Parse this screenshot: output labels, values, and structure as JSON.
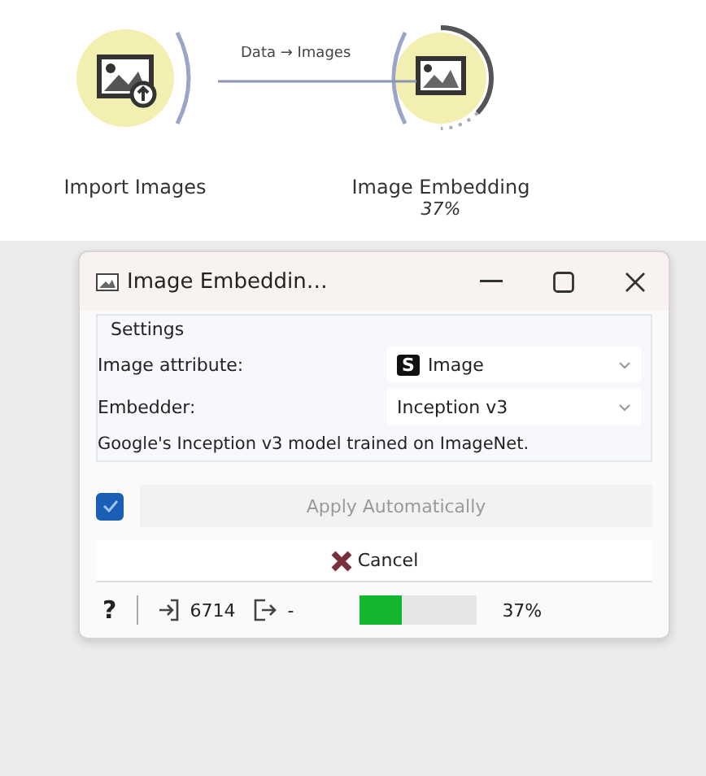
{
  "workflow": {
    "nodes": [
      {
        "kind": "import",
        "label": "Import Images"
      },
      {
        "kind": "embed",
        "label": "Image Embedding",
        "progress_text": "37%",
        "level": 0.37
      }
    ],
    "link": {
      "label": "Data → Images"
    }
  },
  "dialog": {
    "title": "Image Embeddin…",
    "settings": {
      "title": "Settings",
      "fields": [
        {
          "label": "Image attribute:",
          "badge": "S",
          "value": "Image"
        },
        {
          "label": "Embedder:",
          "value": "Inception v3"
        }
      ],
      "description": "Google's Inception v3 model trained on ImageNet."
    },
    "apply": {
      "label": "Apply Automatically",
      "checked": true,
      "disabled": true
    },
    "cancel": "Cancel",
    "status": {
      "help": "?",
      "input_count": "6714",
      "output_count": "-",
      "progress": {
        "level": 0.37
      },
      "progress_text": "37%"
    }
  }
}
